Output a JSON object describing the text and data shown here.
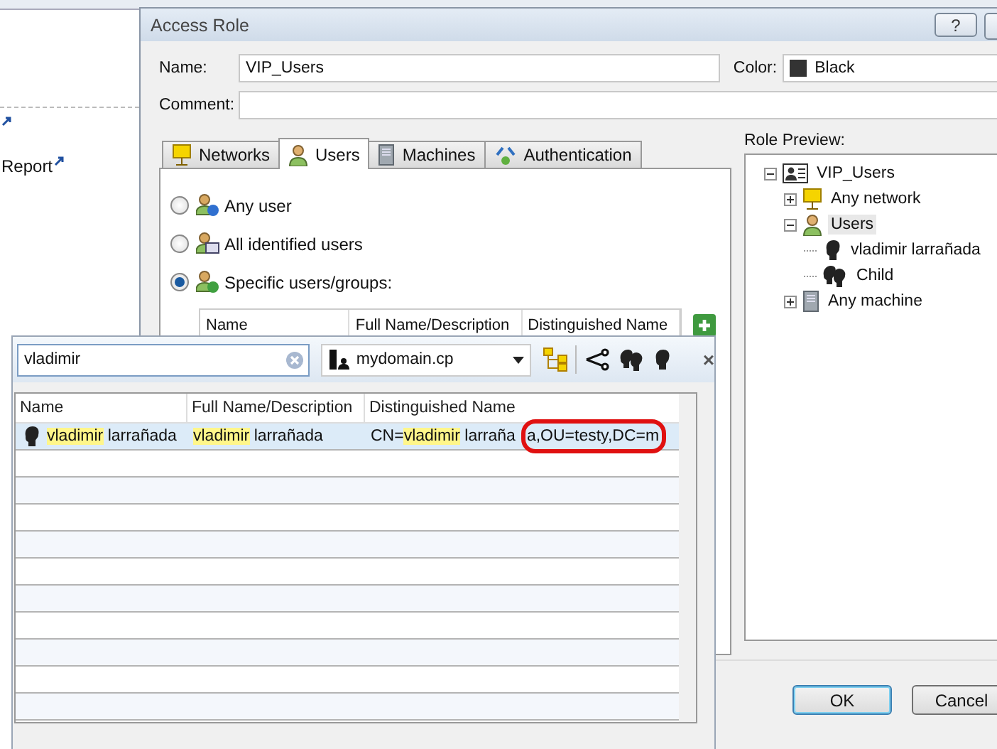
{
  "background_app": {
    "report_link": {
      "label": "Report"
    }
  },
  "dialog": {
    "title": "Access Role",
    "help_button": "?",
    "name_field": {
      "label": "Name:",
      "value": "VIP_Users"
    },
    "color_field": {
      "label": "Color:",
      "value": "Black"
    },
    "comment_field": {
      "label": "Comment:"
    },
    "tabs": [
      {
        "label": "Networks",
        "kind": "network",
        "selected": false
      },
      {
        "label": "Users",
        "kind": "users",
        "selected": true
      },
      {
        "label": "Machines",
        "kind": "machine",
        "selected": false
      },
      {
        "label": "Authentication",
        "kind": "auth",
        "selected": false
      }
    ],
    "user_options": [
      {
        "label": "Any user",
        "kind": "any",
        "selected": false
      },
      {
        "label": "All identified users",
        "kind": "identified",
        "selected": false
      },
      {
        "label": "Specific users/groups:",
        "kind": "specific",
        "selected": true
      }
    ],
    "members_table": {
      "columns": [
        "Name",
        "Full Name/Description",
        "Distinguished Name"
      ]
    },
    "role_preview": {
      "label": "Role Preview:",
      "tree": [
        {
          "label": "VIP_Users",
          "kind": "role",
          "expanded": true,
          "selected": false,
          "children": [
            {
              "label": "Any network",
              "kind": "network",
              "expanded": false,
              "selected": false
            },
            {
              "label": "Users",
              "kind": "users",
              "expanded": true,
              "selected": true,
              "children": [
                {
                  "label": "vladimir larrañada",
                  "kind": "user",
                  "selected": false
                },
                {
                  "label": "Child",
                  "kind": "group",
                  "selected": false
                }
              ]
            },
            {
              "label": "Any machine",
              "kind": "machine",
              "expanded": false,
              "selected": false
            }
          ]
        }
      ]
    },
    "buttons": [
      {
        "label": "OK",
        "default": true
      },
      {
        "label": "Cancel",
        "default": false
      }
    ]
  },
  "picker": {
    "search": {
      "value": "vladimir"
    },
    "domain": {
      "value": "mydomain.cp"
    },
    "close_button": "×",
    "columns": [
      "Name",
      "Full Name/Description",
      "Distinguished Name"
    ],
    "rows": [
      {
        "selected": true,
        "kind": "user",
        "cells": [
          [
            {
              "text": "vladimir",
              "highlighted": true
            },
            {
              "text": " larrañada",
              "highlighted": false
            }
          ],
          [
            {
              "text": "vladimir",
              "highlighted": true
            },
            {
              "text": " larrañada",
              "highlighted": false
            }
          ],
          [
            {
              "text": "CN=",
              "highlighted": false
            },
            {
              "text": "vladimir",
              "highlighted": true
            },
            {
              "text": " larraña",
              "highlighted": false
            },
            {
              "text": "a,OU=testy,DC=m",
              "highlighted": false,
              "outlined": true
            }
          ]
        ]
      }
    ]
  }
}
